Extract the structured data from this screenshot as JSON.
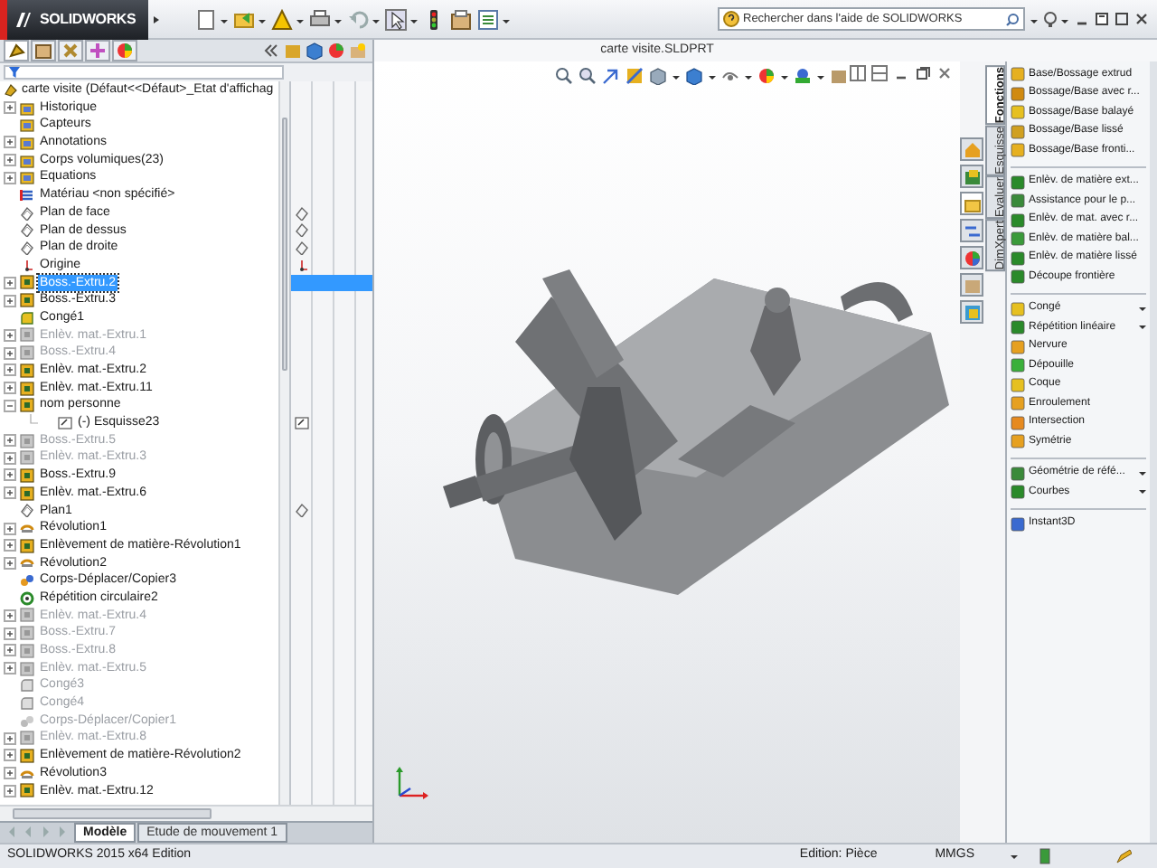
{
  "app": {
    "logo": "SOLIDWORKS",
    "search": {
      "placeholder": "Rechercher dans l'aide de SOLIDWORKS"
    }
  },
  "document": {
    "title": "carte visite.SLDPRT"
  },
  "feature_tree": {
    "root": "carte visite  (Défaut<<Défaut>_Etat d'affichag",
    "items": [
      {
        "label": "Historique",
        "kind": "folder",
        "expandable": true,
        "expanded": false,
        "suppressed": false,
        "selected": false
      },
      {
        "label": "Capteurs",
        "kind": "folder",
        "expandable": false,
        "expanded": false,
        "suppressed": false,
        "selected": false
      },
      {
        "label": "Annotations",
        "kind": "folder",
        "expandable": true,
        "expanded": false,
        "suppressed": false,
        "selected": false
      },
      {
        "label": "Corps volumiques(23)",
        "kind": "folder",
        "expandable": true,
        "expanded": false,
        "suppressed": false,
        "selected": false
      },
      {
        "label": "Equations",
        "kind": "folder",
        "expandable": true,
        "expanded": false,
        "suppressed": false,
        "selected": false
      },
      {
        "label": "Matériau <non spécifié>",
        "kind": "material",
        "expandable": false,
        "expanded": false,
        "suppressed": false,
        "selected": false
      },
      {
        "label": "Plan de face",
        "kind": "plane",
        "expandable": false,
        "expanded": false,
        "suppressed": false,
        "selected": false
      },
      {
        "label": "Plan de dessus",
        "kind": "plane",
        "expandable": false,
        "expanded": false,
        "suppressed": false,
        "selected": false
      },
      {
        "label": "Plan de droite",
        "kind": "plane",
        "expandable": false,
        "expanded": false,
        "suppressed": false,
        "selected": false
      },
      {
        "label": "Origine",
        "kind": "origin",
        "expandable": false,
        "expanded": false,
        "suppressed": false,
        "selected": false
      },
      {
        "label": "Boss.-Extru.2",
        "kind": "feature",
        "expandable": true,
        "expanded": false,
        "suppressed": false,
        "selected": true
      },
      {
        "label": "Boss.-Extru.3",
        "kind": "feature",
        "expandable": true,
        "expanded": false,
        "suppressed": false,
        "selected": false
      },
      {
        "label": "Congé1",
        "kind": "fillet",
        "expandable": false,
        "expanded": false,
        "suppressed": false,
        "selected": false
      },
      {
        "label": "Enlèv. mat.-Extru.1",
        "kind": "feature",
        "expandable": true,
        "expanded": false,
        "suppressed": true,
        "selected": false
      },
      {
        "label": "Boss.-Extru.4",
        "kind": "feature",
        "expandable": true,
        "expanded": false,
        "suppressed": true,
        "selected": false
      },
      {
        "label": "Enlèv. mat.-Extru.2",
        "kind": "feature",
        "expandable": true,
        "expanded": false,
        "suppressed": false,
        "selected": false
      },
      {
        "label": "Enlèv. mat.-Extru.11",
        "kind": "feature",
        "expandable": true,
        "expanded": false,
        "suppressed": false,
        "selected": false
      },
      {
        "label": "nom personne",
        "kind": "feature",
        "expandable": true,
        "expanded": true,
        "suppressed": false,
        "selected": false,
        "children": [
          {
            "label": "(-) Esquisse23",
            "kind": "sketch",
            "expandable": false,
            "expanded": false,
            "suppressed": false,
            "selected": false
          }
        ]
      },
      {
        "label": "Boss.-Extru.5",
        "kind": "feature",
        "expandable": true,
        "expanded": false,
        "suppressed": true,
        "selected": false
      },
      {
        "label": "Enlèv. mat.-Extru.3",
        "kind": "feature",
        "expandable": true,
        "expanded": false,
        "suppressed": true,
        "selected": false
      },
      {
        "label": "Boss.-Extru.9",
        "kind": "feature",
        "expandable": true,
        "expanded": false,
        "suppressed": false,
        "selected": false
      },
      {
        "label": "Enlèv. mat.-Extru.6",
        "kind": "feature",
        "expandable": true,
        "expanded": false,
        "suppressed": false,
        "selected": false
      },
      {
        "label": "Plan1",
        "kind": "plane",
        "expandable": false,
        "expanded": false,
        "suppressed": false,
        "selected": false
      },
      {
        "label": "Révolution1",
        "kind": "revolve",
        "expandable": true,
        "expanded": false,
        "suppressed": false,
        "selected": false
      },
      {
        "label": "Enlèvement de matière-Révolution1",
        "kind": "feature",
        "expandable": true,
        "expanded": false,
        "suppressed": false,
        "selected": false
      },
      {
        "label": "Révolution2",
        "kind": "revolve",
        "expandable": true,
        "expanded": false,
        "suppressed": false,
        "selected": false
      },
      {
        "label": "Corps-Déplacer/Copier3",
        "kind": "move",
        "expandable": false,
        "expanded": false,
        "suppressed": false,
        "selected": false
      },
      {
        "label": "Répétition circulaire2",
        "kind": "pattern",
        "expandable": false,
        "expanded": false,
        "suppressed": false,
        "selected": false
      },
      {
        "label": "Enlèv. mat.-Extru.4",
        "kind": "feature",
        "expandable": true,
        "expanded": false,
        "suppressed": true,
        "selected": false
      },
      {
        "label": "Boss.-Extru.7",
        "kind": "feature",
        "expandable": true,
        "expanded": false,
        "suppressed": true,
        "selected": false
      },
      {
        "label": "Boss.-Extru.8",
        "kind": "feature",
        "expandable": true,
        "expanded": false,
        "suppressed": true,
        "selected": false
      },
      {
        "label": "Enlèv. mat.-Extru.5",
        "kind": "feature",
        "expandable": true,
        "expanded": false,
        "suppressed": true,
        "selected": false
      },
      {
        "label": "Congé3",
        "kind": "fillet",
        "expandable": false,
        "expanded": false,
        "suppressed": true,
        "selected": false
      },
      {
        "label": "Congé4",
        "kind": "fillet",
        "expandable": false,
        "expanded": false,
        "suppressed": true,
        "selected": false
      },
      {
        "label": "Corps-Déplacer/Copier1",
        "kind": "move",
        "expandable": false,
        "expanded": false,
        "suppressed": true,
        "selected": false
      },
      {
        "label": "Enlèv. mat.-Extru.8",
        "kind": "feature",
        "expandable": true,
        "expanded": false,
        "suppressed": true,
        "selected": false
      },
      {
        "label": "Enlèvement de matière-Révolution2",
        "kind": "feature",
        "expandable": true,
        "expanded": false,
        "suppressed": false,
        "selected": false
      },
      {
        "label": "Révolution3",
        "kind": "revolve",
        "expandable": true,
        "expanded": false,
        "suppressed": false,
        "selected": false
      },
      {
        "label": "Enlèv. mat.-Extru.12",
        "kind": "feature",
        "expandable": true,
        "expanded": false,
        "suppressed": false,
        "selected": false
      }
    ]
  },
  "bottom_tabs": [
    {
      "label": "Modèle",
      "selected": true
    },
    {
      "label": "Etude de mouvement 1",
      "selected": false
    }
  ],
  "task_pane_tabs": [
    {
      "selected": false
    },
    {
      "selected": false
    },
    {
      "selected": true
    },
    {
      "selected": false
    },
    {
      "selected": false
    },
    {
      "selected": false
    },
    {
      "selected": false
    }
  ],
  "command_tabs": [
    {
      "label": "Fonctions",
      "selected": true
    },
    {
      "label": "Esquisse",
      "selected": false
    },
    {
      "label": "Evaluer",
      "selected": false
    },
    {
      "label": "DimXpert",
      "selected": false
    }
  ],
  "command_groups": [
    [
      {
        "label": "Base/Bossage extrud",
        "dropdown": false
      },
      {
        "label": "Bossage/Base avec r...",
        "dropdown": false
      },
      {
        "label": "Bossage/Base balayé",
        "dropdown": false
      },
      {
        "label": "Bossage/Base lissé",
        "dropdown": false
      },
      {
        "label": "Bossage/Base fronti...",
        "dropdown": false
      }
    ],
    [
      {
        "label": "Enlèv. de matière ext...",
        "dropdown": false
      },
      {
        "label": "Assistance pour le p...",
        "dropdown": false
      },
      {
        "label": "Enlèv. de mat. avec r...",
        "dropdown": false
      },
      {
        "label": "Enlèv. de matière bal...",
        "dropdown": false
      },
      {
        "label": "Enlèv. de matière lissé",
        "dropdown": false
      },
      {
        "label": "Découpe frontière",
        "dropdown": false
      }
    ],
    [
      {
        "label": "Congé",
        "dropdown": true
      },
      {
        "label": "Répétition linéaire",
        "dropdown": true
      },
      {
        "label": "Nervure",
        "dropdown": false
      },
      {
        "label": "Dépouille",
        "dropdown": false
      },
      {
        "label": "Coque",
        "dropdown": false
      },
      {
        "label": "Enroulement",
        "dropdown": false
      },
      {
        "label": "Intersection",
        "dropdown": false
      },
      {
        "label": "Symétrie",
        "dropdown": false
      }
    ],
    [
      {
        "label": "Géométrie de réfé...",
        "dropdown": true
      },
      {
        "label": "Courbes",
        "dropdown": true
      }
    ],
    [
      {
        "label": "Instant3D",
        "dropdown": false
      }
    ]
  ],
  "status_bar": {
    "version": "SOLIDWORKS 2015 x64 Edition",
    "mode": "Edition: Pièce",
    "units": "MMGS"
  }
}
